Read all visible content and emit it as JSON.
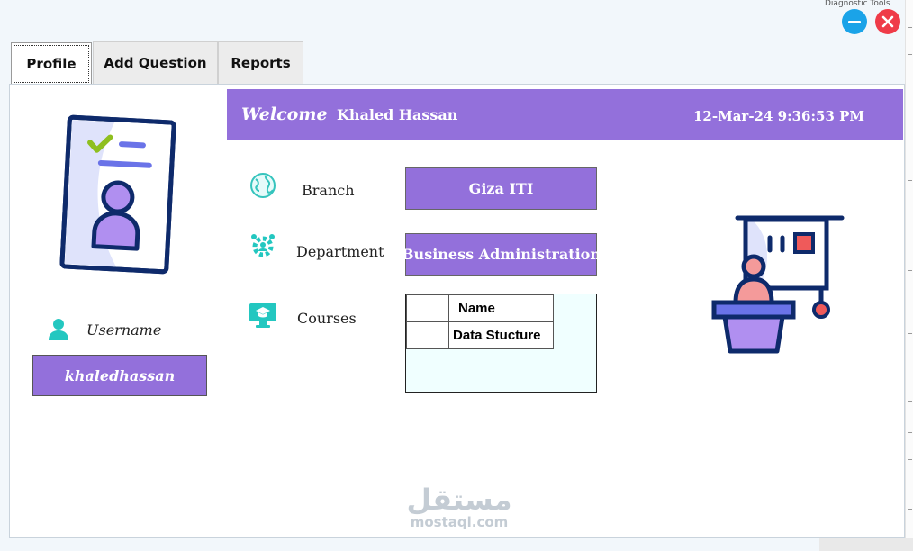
{
  "window": {
    "behind_text": "Diagnostic Tools"
  },
  "tabs": [
    {
      "label": "Profile",
      "active": true
    },
    {
      "label": "Add Question",
      "active": false
    },
    {
      "label": "Reports",
      "active": false
    }
  ],
  "header": {
    "welcome": "Welcome",
    "user_name": "Khaled Hassan",
    "datetime": "12-Mar-24 9:36:53 PM"
  },
  "profile": {
    "username_label": "Username",
    "username_value": "khaledhassan"
  },
  "fields": {
    "branch_label": "Branch",
    "branch_value": "Giza ITI",
    "department_label": "Department",
    "department_value": "Business Administration",
    "courses_label": "Courses"
  },
  "courses": {
    "column_header": "Name",
    "rows": [
      "Data Stucture"
    ]
  },
  "watermark": {
    "arabic": "مستقل",
    "latin": "mostaql.com"
  },
  "colors": {
    "accent": "#9370db",
    "icon_teal": "#23c7c0",
    "icon_navy": "#0e2a6b",
    "minimize": "#1aa3e8",
    "close": "#ef3b48"
  },
  "icons": {
    "card": "id-card-icon",
    "user": "user-icon",
    "branch": "globe-icon",
    "department": "gear-people-icon",
    "courses": "monitor-graduation-icon",
    "teacher": "presenter-icon"
  }
}
